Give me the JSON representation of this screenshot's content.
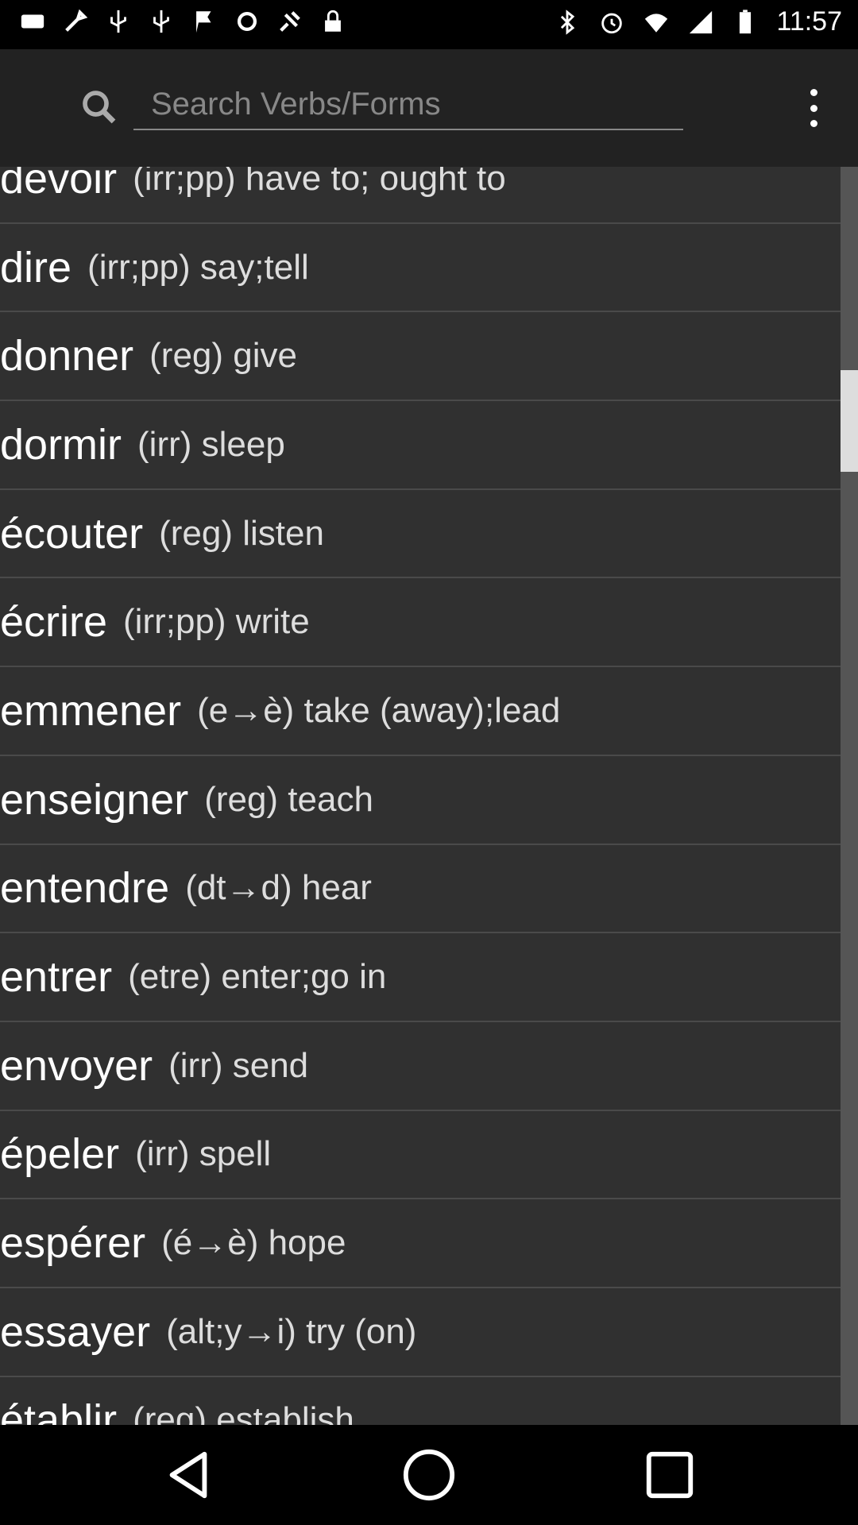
{
  "status_bar": {
    "time": "11:57",
    "left_icons": [
      "keyboard-icon",
      "wrench-icon",
      "usb-icon",
      "usb-icon",
      "flag-icon",
      "sync-icon",
      "fake-gps-icon",
      "lock-icon"
    ],
    "right_icons": [
      "bluetooth-icon",
      "alarm-icon",
      "wifi-icon",
      "signal-icon",
      "battery-icon"
    ]
  },
  "search": {
    "placeholder": "Search Verbs/Forms",
    "value": ""
  },
  "verbs": [
    {
      "verb": "devoir",
      "desc": "(irr;pp) have to; ought to"
    },
    {
      "verb": "dire",
      "desc": "(irr;pp) say;tell"
    },
    {
      "verb": "donner",
      "desc": "(reg) give"
    },
    {
      "verb": "dormir",
      "desc": "(irr) sleep"
    },
    {
      "verb": "écouter",
      "desc": "(reg) listen"
    },
    {
      "verb": "écrire",
      "desc": "(irr;pp) write"
    },
    {
      "verb": "emmener",
      "desc": "(e→è) take (away);lead"
    },
    {
      "verb": "enseigner",
      "desc": "(reg) teach"
    },
    {
      "verb": "entendre",
      "desc": "(dt→d) hear"
    },
    {
      "verb": "entrer",
      "desc": "(etre) enter;go in"
    },
    {
      "verb": "envoyer",
      "desc": "(irr) send"
    },
    {
      "verb": "épeler",
      "desc": "(irr) spell"
    },
    {
      "verb": "espérer",
      "desc": "(é→è) hope"
    },
    {
      "verb": "essayer",
      "desc": "(alt;y→i) try (on)"
    },
    {
      "verb": "établir",
      "desc": "(reg) establish"
    }
  ],
  "colors": {
    "background": "#303030",
    "action_bar": "#222222",
    "divider": "#4a4a4a"
  }
}
